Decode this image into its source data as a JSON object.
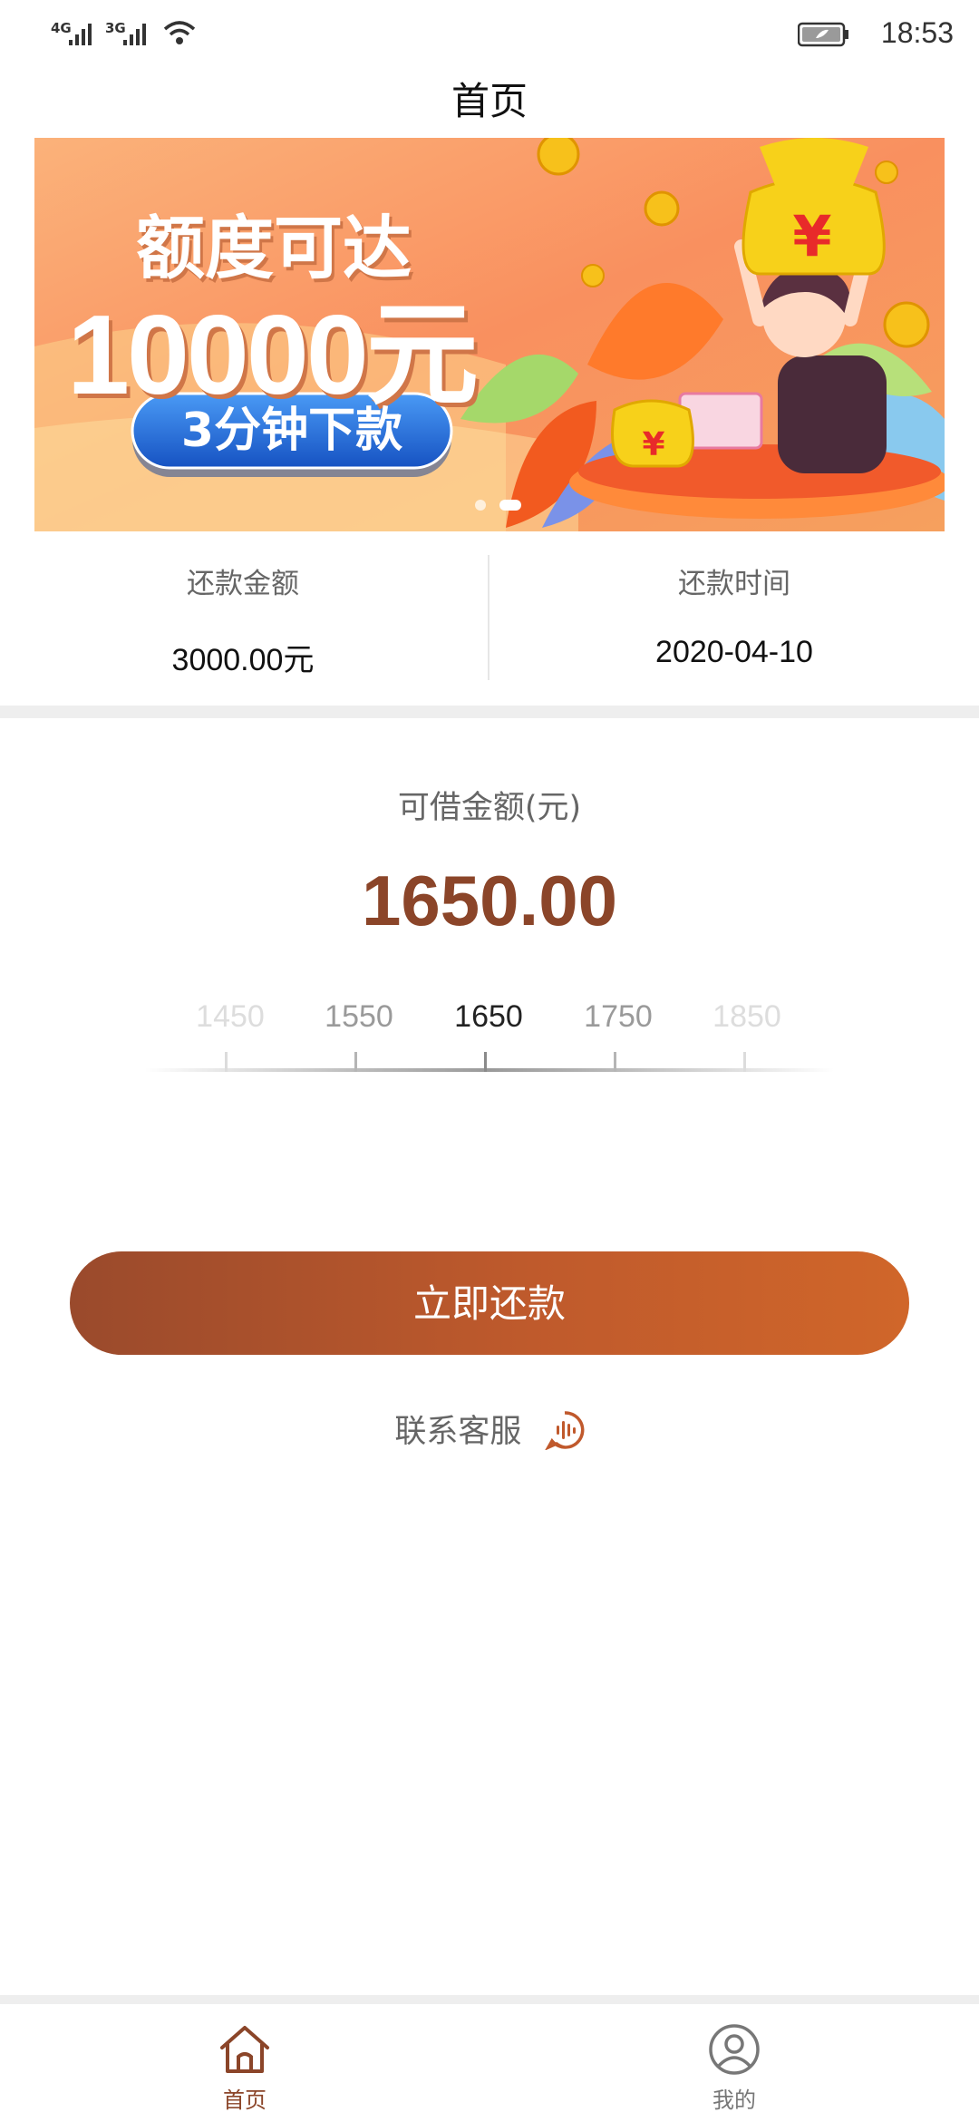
{
  "status_bar": {
    "signal_1_label": "4G",
    "signal_2_label": "3G",
    "icons": [
      "signal-4g-icon",
      "signal-3g-icon",
      "wifi-icon",
      "battery-icon"
    ],
    "time": "18:53"
  },
  "header": {
    "title": "首页"
  },
  "banner": {
    "headline": "额度可达",
    "amount": "10000元",
    "button_text": "3分钟下款",
    "page_indicator": {
      "count": 2,
      "active_index": 1
    }
  },
  "repay_info": {
    "amount_label": "还款金额",
    "amount_value": "3000.00元",
    "date_label": "还款时间",
    "date_value": "2020-04-10"
  },
  "borrow": {
    "label": "可借金额(元)",
    "amount": "1650.00",
    "scale": [
      {
        "value": "1450"
      },
      {
        "value": "1550"
      },
      {
        "value": "1650"
      },
      {
        "value": "1750"
      },
      {
        "value": "1850"
      }
    ],
    "selected_value": "1650"
  },
  "actions": {
    "repay_button": "立即还款",
    "contact_label": "联系客服"
  },
  "tab_bar": {
    "items": [
      {
        "label": "首页",
        "icon": "home-icon",
        "active": true
      },
      {
        "label": "我的",
        "icon": "profile-icon",
        "active": false
      }
    ]
  },
  "colors": {
    "brand": "#8b4529",
    "button_start": "#9a4a2c",
    "button_end": "#d0662a",
    "banner_button": "#1f64d6"
  }
}
